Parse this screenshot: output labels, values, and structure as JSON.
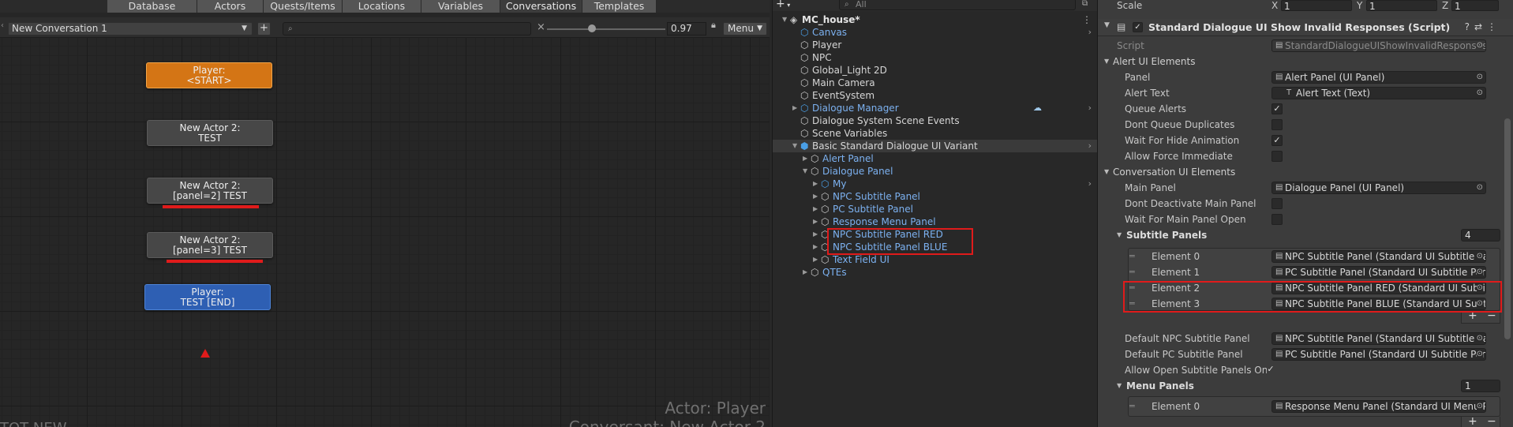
{
  "editor": {
    "tabs": [
      "Database",
      "Actors",
      "Quests/Items",
      "Locations",
      "Variables",
      "Conversations",
      "Templates"
    ],
    "active_tab": "Conversations",
    "conversation_select": "New Conversation 1",
    "add_conversation_label": "+",
    "search_placeholder": "",
    "zoom_value": "0.97",
    "zoom_fraction": 0.38,
    "menu_label": "Menu",
    "nodes": [
      {
        "line1": "Player:",
        "line2": "<START>",
        "kind": "start"
      },
      {
        "line1": "New Actor 2:",
        "line2": "TEST",
        "kind": "npc"
      },
      {
        "line1": "New Actor 2:",
        "line2": "[panel=2] TEST",
        "kind": "npc"
      },
      {
        "line1": "New Actor 2:",
        "line2": "[panel=3] TEST",
        "kind": "npc"
      },
      {
        "line1": "Player:",
        "line2": "TEST [END]",
        "kind": "end"
      }
    ],
    "watermark_actor": "Actor: Player",
    "watermark_conversant": "Conversant: New Actor 2",
    "watermark_title": "TOT NEW"
  },
  "hierarchy": {
    "add_label": "+",
    "search_placeholder": "All",
    "items": [
      {
        "label": "MC_house*",
        "depth": 0,
        "expanded": true,
        "style": "bold",
        "icon": "unity-scene-icon",
        "menu": true
      },
      {
        "label": "Canvas",
        "depth": 1,
        "style": "blue",
        "icon": "prefab-cube-icon",
        "chevron": true
      },
      {
        "label": "Player",
        "depth": 1,
        "style": "white",
        "icon": "gameobject-cube-icon"
      },
      {
        "label": "NPC",
        "depth": 1,
        "style": "white",
        "icon": "gameobject-cube-icon"
      },
      {
        "label": "Global_Light 2D",
        "depth": 1,
        "style": "white",
        "icon": "gameobject-cube-icon"
      },
      {
        "label": "Main Camera",
        "depth": 1,
        "style": "white",
        "icon": "gameobject-cube-icon"
      },
      {
        "label": "EventSystem",
        "depth": 1,
        "style": "white",
        "icon": "gameobject-cube-icon"
      },
      {
        "label": "Dialogue Manager",
        "depth": 1,
        "style": "blue",
        "icon": "prefab-cube-icon",
        "collapsed": true,
        "chevron": true,
        "cloud": true
      },
      {
        "label": "Dialogue System Scene Events",
        "depth": 1,
        "style": "white",
        "icon": "gameobject-cube-icon"
      },
      {
        "label": "Scene Variables",
        "depth": 1,
        "style": "white",
        "icon": "gameobject-cube-icon"
      },
      {
        "label": "Basic Standard Dialogue UI Variant",
        "depth": 1,
        "style": "white",
        "icon": "prefab-variant-icon",
        "expanded": true,
        "selected": true,
        "chevron": true
      },
      {
        "label": "Alert Panel",
        "depth": 2,
        "style": "blue",
        "icon": "gameobject-cube-icon",
        "collapsed": true
      },
      {
        "label": "Dialogue Panel",
        "depth": 2,
        "style": "blue",
        "icon": "gameobject-cube-icon",
        "expanded": true
      },
      {
        "label": "My",
        "depth": 3,
        "style": "blue",
        "icon": "prefab-cube-icon",
        "collapsed": true,
        "chevron": true
      },
      {
        "label": "NPC Subtitle Panel",
        "depth": 3,
        "style": "blue",
        "icon": "gameobject-cube-icon",
        "collapsed": true
      },
      {
        "label": "PC Subtitle Panel",
        "depth": 3,
        "style": "blue",
        "icon": "gameobject-cube-icon",
        "collapsed": true
      },
      {
        "label": "Response Menu Panel",
        "depth": 3,
        "style": "blue",
        "icon": "gameobject-cube-icon",
        "collapsed": true
      },
      {
        "label": "NPC Subtitle Panel RED",
        "depth": 3,
        "style": "blue",
        "icon": "gameobject-cube-icon",
        "collapsed": true
      },
      {
        "label": "NPC Subtitle Panel BLUE",
        "depth": 3,
        "style": "blue",
        "icon": "gameobject-cube-icon",
        "collapsed": true
      },
      {
        "label": "Text Field UI",
        "depth": 3,
        "style": "blue",
        "icon": "gameobject-cube-icon",
        "collapsed": true
      },
      {
        "label": "QTEs",
        "depth": 2,
        "style": "blue",
        "icon": "gameobject-cube-icon",
        "collapsed": true
      }
    ]
  },
  "inspector": {
    "scale": {
      "label": "Scale",
      "x_label": "X",
      "x": "1",
      "y_label": "Y",
      "y": "1",
      "z_label": "Z",
      "z": "1"
    },
    "component_title": "Standard Dialogue UI Show Invalid Responses (Script)",
    "script_label": "Script",
    "script_value": "StandardDialogueUIShowInvalidResponses",
    "alert_section": "Alert UI Elements",
    "panel_label": "Panel",
    "panel_value": "Alert Panel (UI Panel)",
    "alert_text_label": "Alert Text",
    "alert_text_value": "Alert Text (Text)",
    "queue_alerts_label": "Queue Alerts",
    "queue_alerts": true,
    "dont_queue_dupes_label": "Dont Queue Duplicates",
    "dont_queue_dupes": false,
    "wait_hide_label": "Wait For Hide Animation",
    "wait_hide": true,
    "allow_force_label": "Allow Force Immediate",
    "allow_force": false,
    "conv_section": "Conversation UI Elements",
    "main_panel_label": "Main Panel",
    "main_panel_value": "Dialogue Panel (UI Panel)",
    "dont_deactivate_label": "Dont Deactivate Main Panel",
    "dont_deactivate": false,
    "wait_main_label": "Wait For Main Panel Open",
    "wait_main": false,
    "subtitle_panels_label": "Subtitle Panels",
    "subtitle_panels_count": "4",
    "subtitle_elements": [
      {
        "label": "Element 0",
        "value": "NPC Subtitle Panel (Standard UI Subtitle Panel)"
      },
      {
        "label": "Element 1",
        "value": "PC Subtitle Panel (Standard UI Subtitle Panel)"
      },
      {
        "label": "Element 2",
        "value": "NPC Subtitle Panel RED (Standard UI Subtitle Panel)"
      },
      {
        "label": "Element 3",
        "value": "NPC Subtitle Panel BLUE (Standard UI Subtitle Panel)"
      }
    ],
    "default_npc_label": "Default NPC Subtitle Panel",
    "default_npc_value": "NPC Subtitle Panel (Standard UI Subtitle Panel)",
    "default_pc_label": "Default PC Subtitle Panel",
    "default_pc_value": "PC Subtitle Panel (Standard UI Subtitle Panel)",
    "allow_open_label": "Allow Open Subtitle Panels On S",
    "allow_open": true,
    "menu_panels_label": "Menu Panels",
    "menu_panels_count": "1",
    "menu_elements": [
      {
        "label": "Element 0",
        "value": "Response Menu Panel (Standard UI Menu Panel)"
      }
    ],
    "plus_label": "+",
    "minus_label": "−"
  },
  "colors": {
    "highlight_red": "#e01b1b",
    "start_node": "#d47515",
    "end_node": "#2e5fb3",
    "npc_node": "#474747",
    "hierarchy_blue": "#7cb1f0"
  }
}
